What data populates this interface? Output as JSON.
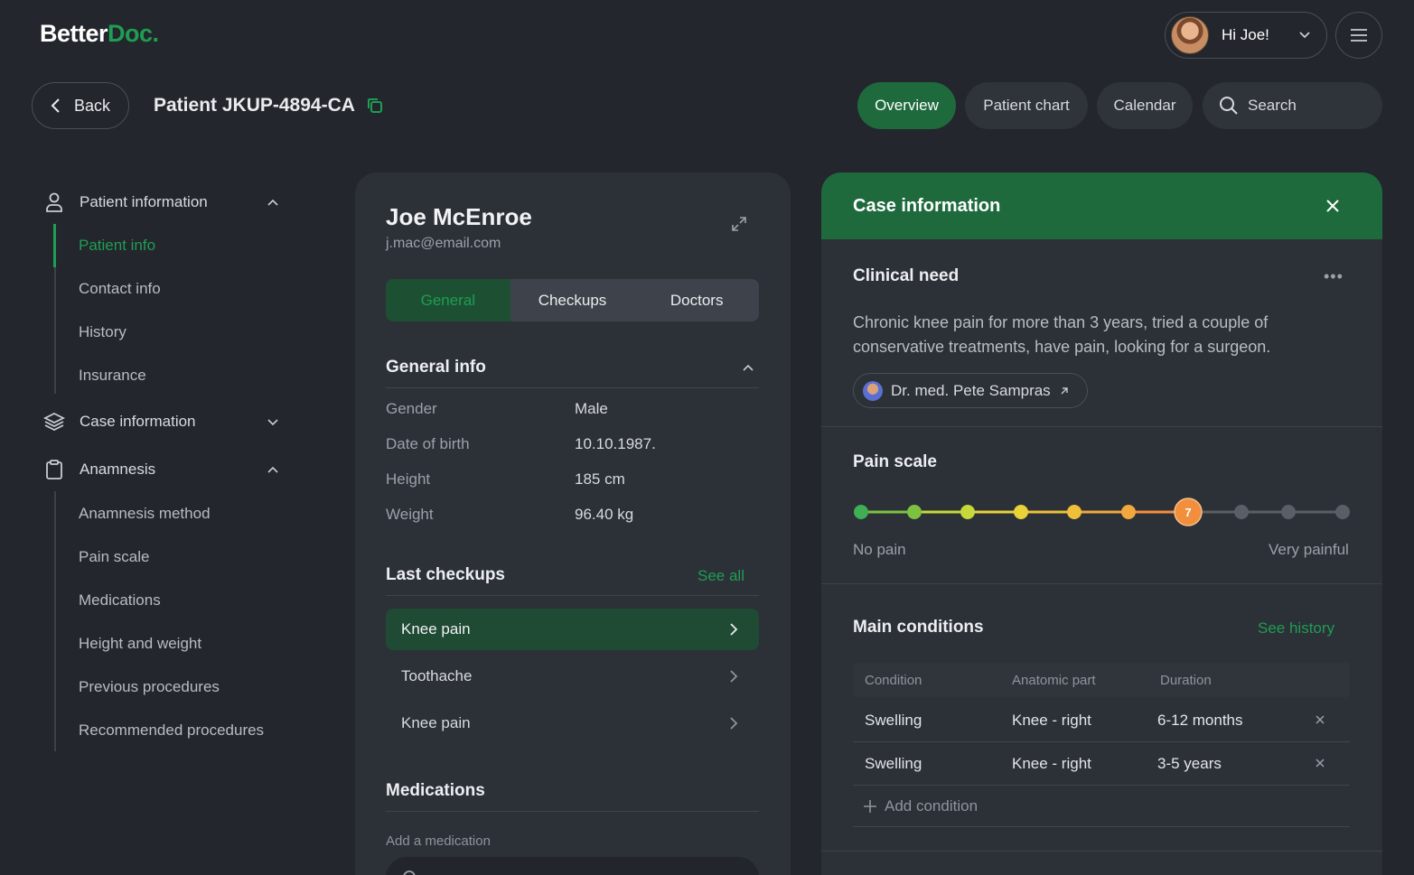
{
  "brand": {
    "name_part1": "Better",
    "name_part2": "Doc."
  },
  "user": {
    "greeting": "Hi Joe!"
  },
  "topbar": {
    "back_label": "Back",
    "patient_title": "Patient JKUP-4894-CA",
    "nav": [
      {
        "label": "Overview",
        "active": true
      },
      {
        "label": "Patient chart",
        "active": false
      },
      {
        "label": "Calendar",
        "active": false
      }
    ],
    "search_label": "Search"
  },
  "sidebar": {
    "sections": [
      {
        "label": "Patient information",
        "expanded": true,
        "items": [
          {
            "label": "Patient info",
            "active": true
          },
          {
            "label": "Contact info",
            "active": false
          },
          {
            "label": "History",
            "active": false
          },
          {
            "label": "Insurance",
            "active": false
          }
        ]
      },
      {
        "label": "Case information",
        "expanded": false,
        "items": []
      },
      {
        "label": "Anamnesis",
        "expanded": true,
        "items": [
          {
            "label": "Anamnesis method"
          },
          {
            "label": "Pain scale"
          },
          {
            "label": "Medications"
          },
          {
            "label": "Height and weight"
          },
          {
            "label": "Previous procedures"
          },
          {
            "label": "Recommended procedures"
          }
        ]
      }
    ]
  },
  "patient": {
    "name": "Joe McEnroe",
    "email": "j.mac@email.com",
    "tabs": [
      {
        "label": "General",
        "active": true
      },
      {
        "label": "Checkups",
        "active": false
      },
      {
        "label": "Doctors",
        "active": false
      }
    ],
    "general_info": {
      "title": "General info",
      "rows": [
        {
          "label": "Gender",
          "value": "Male"
        },
        {
          "label": "Date of birth",
          "value": "10.10.1987."
        },
        {
          "label": "Height",
          "value": "185 cm"
        },
        {
          "label": "Weight",
          "value": "96.40 kg"
        }
      ]
    },
    "last_checkups": {
      "title": "Last checkups",
      "see_all": "See all",
      "items": [
        {
          "label": "Knee pain",
          "active": true
        },
        {
          "label": "Toothache",
          "active": false
        },
        {
          "label": "Knee pain",
          "active": false
        }
      ]
    },
    "medications": {
      "title": "Medications",
      "add_label": "Add a medication"
    }
  },
  "case_info": {
    "title": "Case information",
    "clinical_need": {
      "title": "Clinical need",
      "text": "Chronic knee pain for more than 3 years, tried a couple of conservative treatments, have pain, looking for a surgeon.",
      "doctor": "Dr. med. Pete Sampras"
    },
    "pain_scale": {
      "title": "Pain scale",
      "value": 7,
      "steps": 10,
      "min_label": "No pain",
      "max_label": "Very painful",
      "colors": [
        "#3fae55",
        "#7cc240",
        "#c6d83a",
        "#e8d238",
        "#f0c03a",
        "#f2a83c",
        "#f28f3c",
        "#5a5f67",
        "#5a5f67",
        "#5a5f67"
      ]
    },
    "main_conditions": {
      "title": "Main conditions",
      "see_history": "See history",
      "columns": [
        "Condition",
        "Anatomic part",
        "Duration"
      ],
      "rows": [
        [
          "Swelling",
          "Knee - right",
          "6-12 months"
        ],
        [
          "Swelling",
          "Knee - right",
          "3-5 years"
        ]
      ],
      "add_label": "Add condition"
    }
  },
  "colors": {
    "accent": "#1f9d52",
    "accent_dark": "#1e6a3d",
    "background": "#23262c",
    "card": "#2c3037"
  }
}
